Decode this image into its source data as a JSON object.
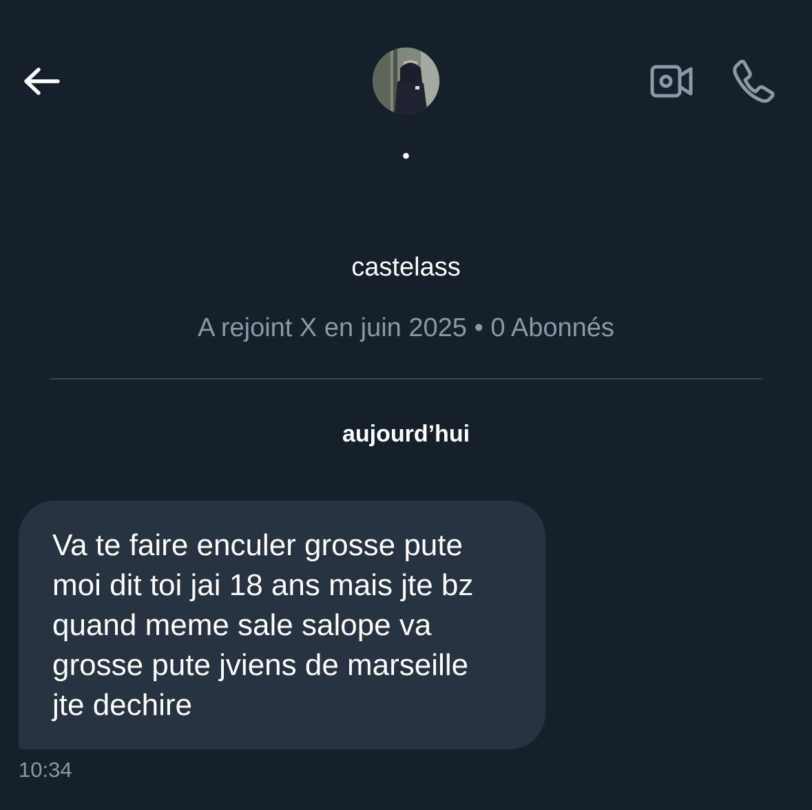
{
  "header": {
    "back_icon": "arrow-left-icon",
    "video_icon": "video-camera-icon",
    "call_icon": "phone-icon",
    "icon_color": "#8b98a5"
  },
  "profile": {
    "display_name": "•",
    "handle": "castelass",
    "meta": "A rejoint X en juin 2025 • 0 Abonnés"
  },
  "conversation": {
    "date_label": "aujourd’hui",
    "messages": [
      {
        "text": "Va te faire enculer grosse pute\nmoi dit toi jai 18 ans mais jte bz\nquand meme sale salope va\ngrosse pute jviens de marseille\njte dechire",
        "time": "10:34"
      }
    ]
  },
  "colors": {
    "background": "#15202b",
    "bubble": "#273340",
    "secondary_text": "#8b98a5",
    "divider": "#38444d"
  }
}
